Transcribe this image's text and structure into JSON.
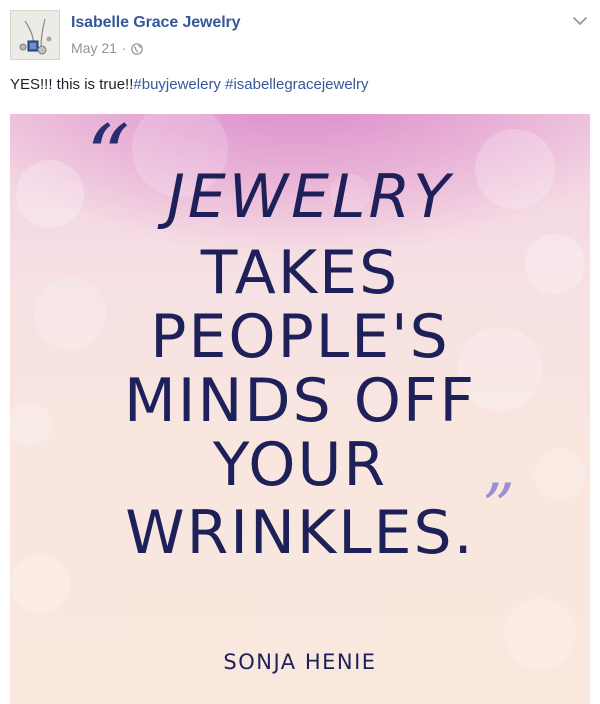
{
  "post": {
    "page_name": "Isabelle Grace Jewelry",
    "date": "May 21",
    "separator": "·",
    "privacy_icon": "globe-icon",
    "menu_icon": "chevron-down-icon",
    "caption_text": "YES!!! this is true!!",
    "hashtags": [
      "#buyjewelery",
      " #isabellegracejewelry"
    ]
  },
  "quote_image": {
    "open_quote": "“",
    "close_quote": "”",
    "lines": [
      "JEWELRY",
      "TAKES",
      "PEOPLE'S",
      "MINDS OFF",
      "YOUR",
      "WRINKLES."
    ],
    "author": "SONJA HENIE"
  },
  "colors": {
    "link": "#365899",
    "meta": "#90949c",
    "text": "#1d2129",
    "quote_text": "#1e2159",
    "close_quote": "#9b8fd3"
  }
}
